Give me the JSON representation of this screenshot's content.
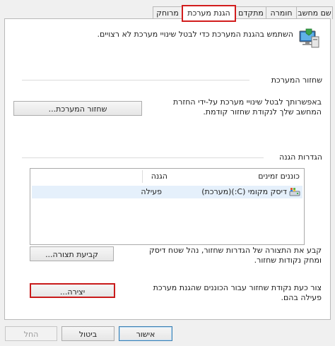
{
  "tabs": [
    {
      "label": "שם מחשב",
      "active": false
    },
    {
      "label": "חומרה",
      "active": false
    },
    {
      "label": "מתקדם",
      "active": false
    },
    {
      "label": "הגנת מערכת",
      "active": true
    },
    {
      "label": "מרוחק",
      "active": false
    }
  ],
  "intro_text": "השתמש בהגנת המערכת כדי לבטל שינויי מערכת לא רצויים.",
  "restore": {
    "section_title": "שחזור המערכת",
    "description": "באפשרותך לבטל שינויי מערכת על-ידי החזרת המחשב שלך לנקודת שחזור קודמת.",
    "button": "שחזור המערכת..."
  },
  "protection": {
    "section_title": "הגדרות הגנה",
    "columns": [
      "כוננים זמינים",
      "הגנה"
    ],
    "rows": [
      {
        "drive": "דיסק מקומי  (C:)(מערכת)",
        "protection": "פעילה"
      }
    ],
    "configure_text": "קבע את התצורה של הגדרות שחזור, נהל שטח דיסק ומחק נקודות שחזור.",
    "configure_button": "קביעת תצורה...",
    "create_text": "צור כעת נקודת שחזור עבור הכוננים שהגנת מערכת פעילה בהם.",
    "create_button": "יצירה..."
  },
  "footer": {
    "ok": "אישור",
    "cancel": "ביטול",
    "apply": "החל"
  }
}
